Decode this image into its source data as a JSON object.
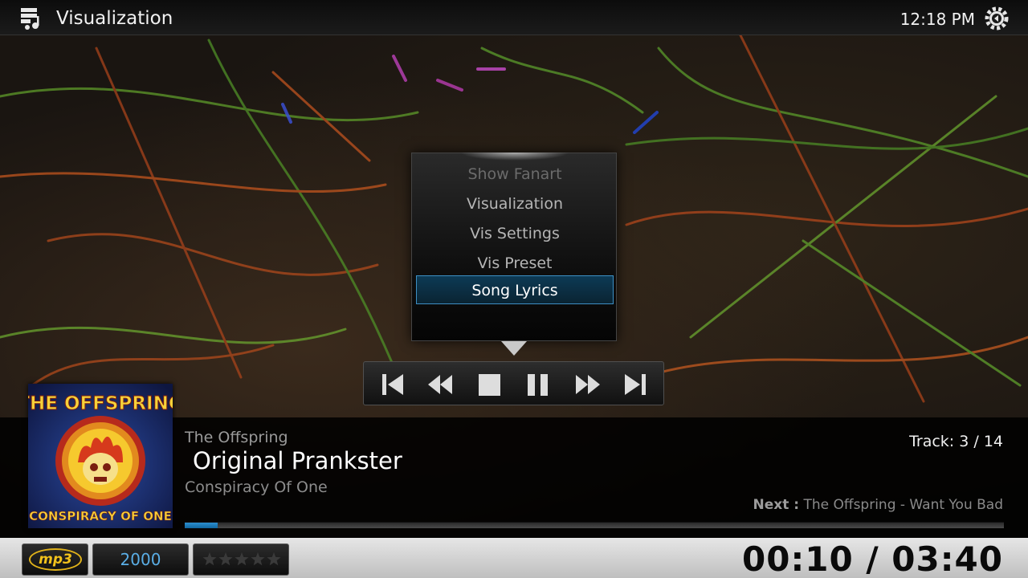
{
  "header": {
    "title": "Visualization",
    "clock": "12:18 PM",
    "app_icon": "music-notes-icon",
    "settings_icon": "gear-icon"
  },
  "context_menu": {
    "items": [
      {
        "label": "Show Fanart",
        "state": "disabled"
      },
      {
        "label": "Visualization",
        "state": "normal"
      },
      {
        "label": "Vis Settings",
        "state": "normal"
      },
      {
        "label": "Vis Preset",
        "state": "normal"
      },
      {
        "label": "Song Lyrics",
        "state": "selected"
      }
    ]
  },
  "transport": {
    "buttons": [
      {
        "name": "previous-track",
        "icon": "skip-back-icon"
      },
      {
        "name": "rewind",
        "icon": "rewind-icon"
      },
      {
        "name": "stop",
        "icon": "stop-icon"
      },
      {
        "name": "pause",
        "icon": "pause-icon"
      },
      {
        "name": "fast-forward",
        "icon": "fast-forward-icon"
      },
      {
        "name": "next-track",
        "icon": "skip-forward-icon"
      }
    ]
  },
  "now_playing": {
    "artist": "The Offspring",
    "title": "Original Prankster",
    "album": "Conspiracy Of One",
    "cover_text_top": "THE OFFSPRING",
    "cover_text_bottom": "CONSPIRACY OF ONE",
    "track": "Track: 3 / 14",
    "next_label": "Next :",
    "next_value": "The Offspring - Want You Bad",
    "progress": 0.04
  },
  "footer": {
    "codec": "mp3",
    "year": "2000",
    "rating": 0,
    "rating_max": 5,
    "time": "00:10 / 03:40"
  },
  "colors": {
    "accent": "#2b8fd0",
    "selected_border": "#3d8fc4",
    "codec_gold": "#f2c21c",
    "year_blue": "#5aaee6"
  }
}
